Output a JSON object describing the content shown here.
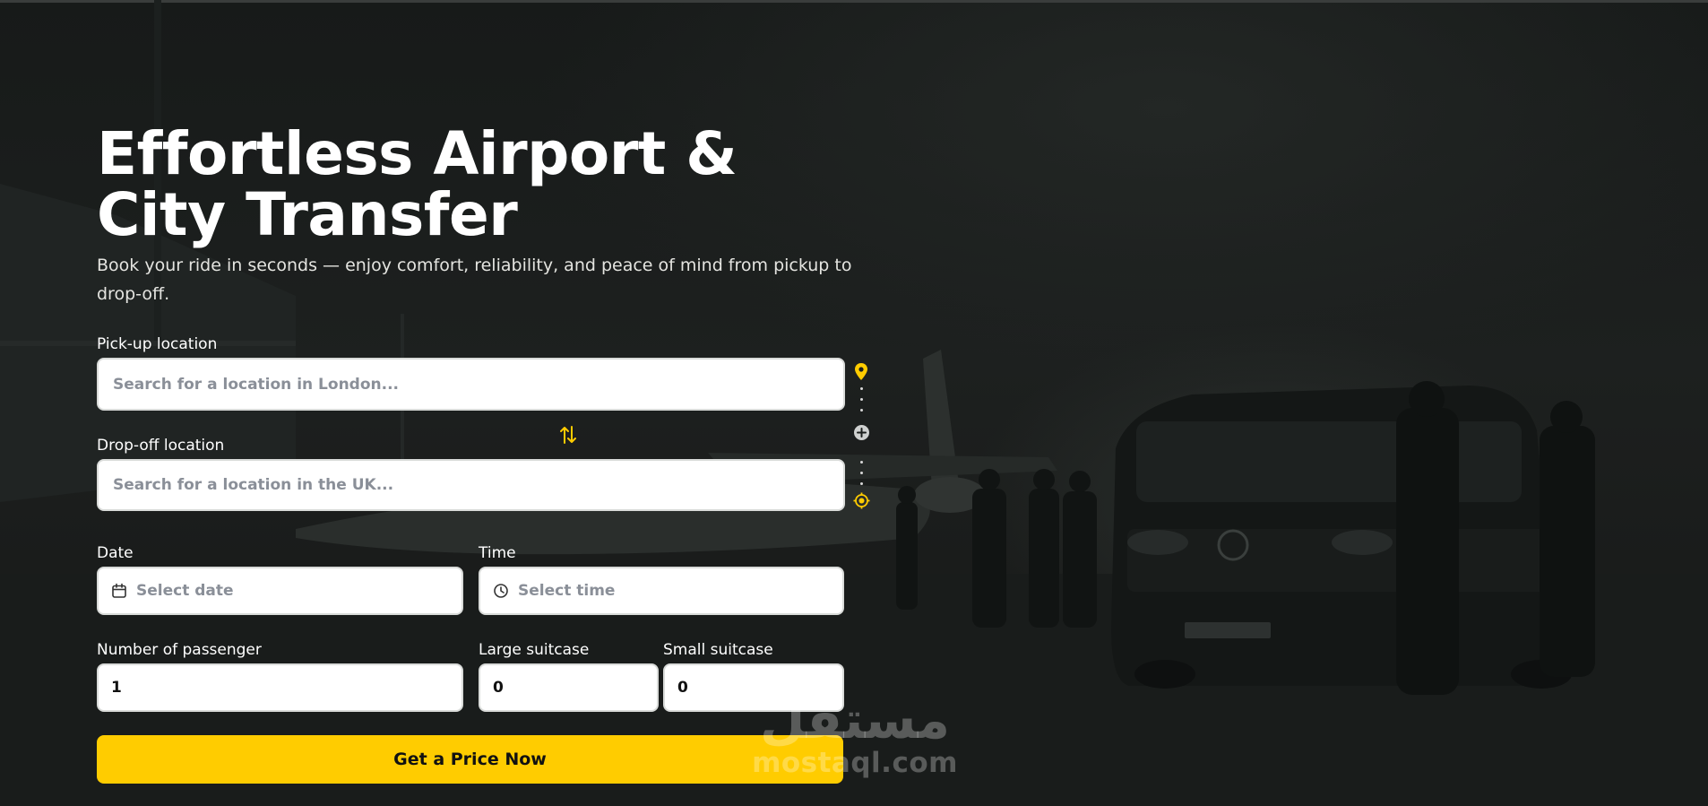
{
  "hero": {
    "title": "Effortless Airport & City Transfer",
    "subtitle": "Book your ride in seconds — enjoy comfort, reliability, and peace of mind from pickup to drop-off."
  },
  "form": {
    "pickup": {
      "label": "Pick-up location",
      "placeholder": "Search for a location in London..."
    },
    "dropoff": {
      "label": "Drop-off location",
      "placeholder": "Search for a location in the UK..."
    },
    "date": {
      "label": "Date",
      "placeholder": "Select date",
      "icon": "calendar-icon"
    },
    "time": {
      "label": "Time",
      "placeholder": "Select time",
      "icon": "clock-icon"
    },
    "passengers": {
      "label": "Number of passenger",
      "value": "1"
    },
    "large_suitcase": {
      "label": "Large suitcase",
      "value": "0"
    },
    "small_suitcase": {
      "label": "Small suitcase",
      "value": "0"
    },
    "submit_label": "Get a Price Now"
  },
  "route_icons": [
    "map-pin-icon",
    "add-stop-icon",
    "target-location-icon",
    "swap-icon"
  ],
  "watermark": {
    "arabic": "مستقل",
    "latin": "mostaql.com"
  },
  "colors": {
    "accent": "#ffcc00",
    "background": "#1b1e1d",
    "text": "#ffffff",
    "placeholder": "#8a8f98"
  }
}
